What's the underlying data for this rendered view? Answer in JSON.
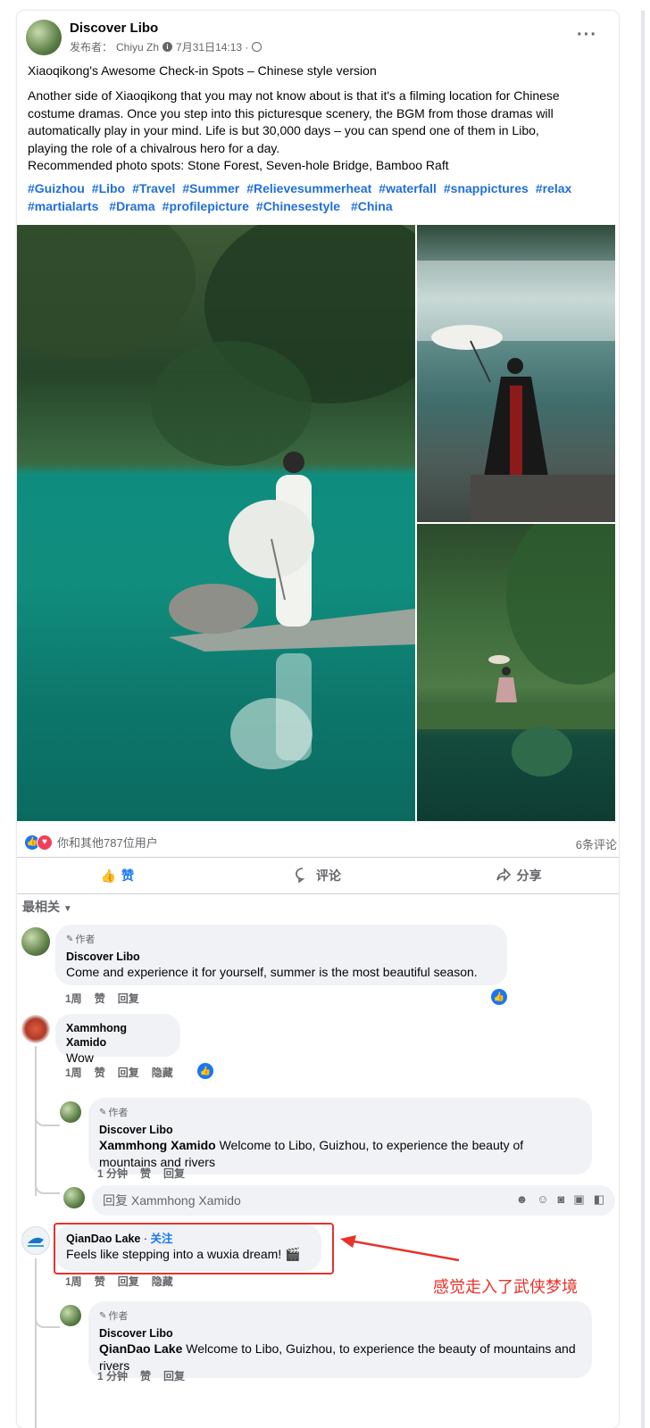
{
  "post": {
    "page_name": "Discover Libo",
    "publisher_prefix": "发布者：",
    "publisher_name": "Chiyu Zh",
    "info_icon": "info-icon",
    "date": "7月31日14:13 ·",
    "privacy_icon": "globe-icon",
    "more_label": "···",
    "title": "Xiaoqikong's Awesome Check-in Spots – Chinese style version",
    "body_lines": [
      "Another side of Xiaoqikong that you may not know about is that it's a filming location for Chinese",
      "costume dramas. Once you step into this picturesque scenery, the BGM from those dramas will",
      "automatically play in your mind. Life is but 30,000 days – you can spend one of them in Libo,",
      "playing the role of a chivalrous hero for a day.",
      "Recommended photo spots: Stone Forest, Seven-hole Bridge, Bamboo Raft"
    ],
    "hashtags": [
      "#Guizhou",
      "#Libo",
      "#Travel",
      "#Summer",
      "#Relievesummerheat",
      "#waterfall",
      "#snappictures",
      "#relax",
      "#martialarts",
      "#Drama",
      "#profilepicture",
      "#Chinesestyle",
      "#China"
    ]
  },
  "reactions": {
    "summary": "你和其他787位用户",
    "comment_count": "6条评论",
    "like_label": "赞",
    "comment_label": "评论",
    "share_label": "分享"
  },
  "sort_label": "最相关",
  "comments": [
    {
      "badge": "作者",
      "name": "Discover Libo",
      "text": "Come and experience it for yourself, summer is the most beautiful season.",
      "time": "1周",
      "like": "赞",
      "reply": "回复"
    },
    {
      "name": "Xammhong Xamido",
      "text": "Wow",
      "time": "1周",
      "like": "赞",
      "reply": "回复",
      "hide": "隐藏"
    },
    {
      "badge": "作者",
      "name": "Discover Libo",
      "mention": "Xammhong Xamido",
      "text": " Welcome to Libo, Guizhou, to experience the beauty of mountains and rivers",
      "time": "1 分钟",
      "like": "赞",
      "reply": "回复"
    },
    {
      "reply_placeholder": "回复 Xammhong Xamido"
    },
    {
      "name": "QianDao Lake",
      "sep": " · ",
      "follow": "关注",
      "text": "Feels like stepping into a wuxia dream! 🎬",
      "time": "1周",
      "like": "赞",
      "reply": "回复",
      "hide": "隐藏"
    },
    {
      "badge": "作者",
      "name": "Discover Libo",
      "mention": "QianDao Lake",
      "text": " Welcome to Libo, Guizhou, to experience the beauty of mountains and rivers",
      "time": "1 分钟",
      "like": "赞",
      "reply": "回复"
    }
  ],
  "annotation": "感觉走入了武侠梦境",
  "colors": {
    "accent": "#1877f2",
    "annotation": "#e8322a",
    "hashtag": "#216fdb"
  }
}
